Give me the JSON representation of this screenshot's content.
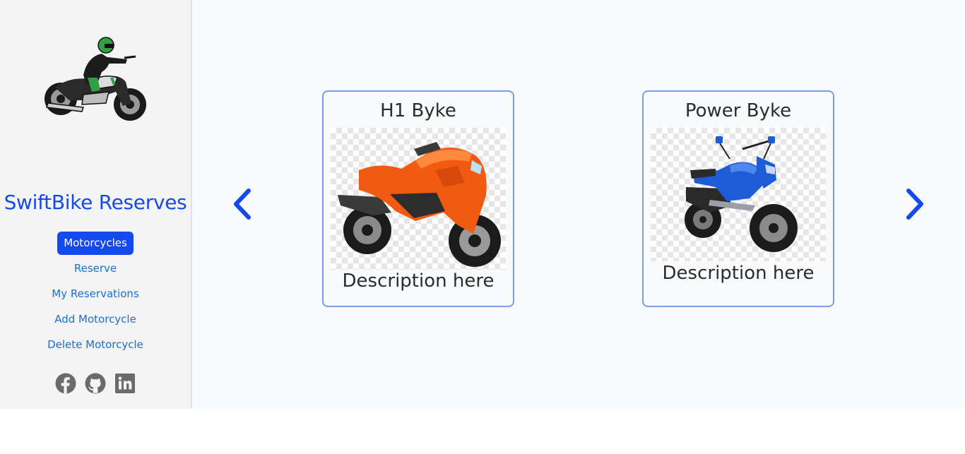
{
  "sidebar": {
    "brand": "SwiftBike Reserves",
    "logo_icon": "motorcycle-rider-logo",
    "nav": [
      {
        "label": "Motorcycles",
        "active": true
      },
      {
        "label": "Reserve",
        "active": false
      },
      {
        "label": "My Reservations",
        "active": false
      },
      {
        "label": "Add Motorcycle",
        "active": false
      },
      {
        "label": "Delete Motorcycle",
        "active": false
      }
    ],
    "socials": [
      "facebook-icon",
      "github-icon",
      "linkedin-icon"
    ]
  },
  "carousel": {
    "prev_icon": "chevron-left-icon",
    "next_icon": "chevron-right-icon",
    "cards": [
      {
        "title": "H1 Byke",
        "description": "Description here",
        "image": "orange-sport-motorcycle"
      },
      {
        "title": "Power Byke",
        "description": "Description here",
        "image": "blue-commuter-motorcycle"
      }
    ]
  },
  "colors": {
    "accent": "#1449ee",
    "brand_text": "#1849e6",
    "nav_link": "#1a6fd6",
    "card_border": "#7f9be3",
    "sidebar_bg": "#f4f4f4",
    "main_bg": "#f8fafb"
  }
}
